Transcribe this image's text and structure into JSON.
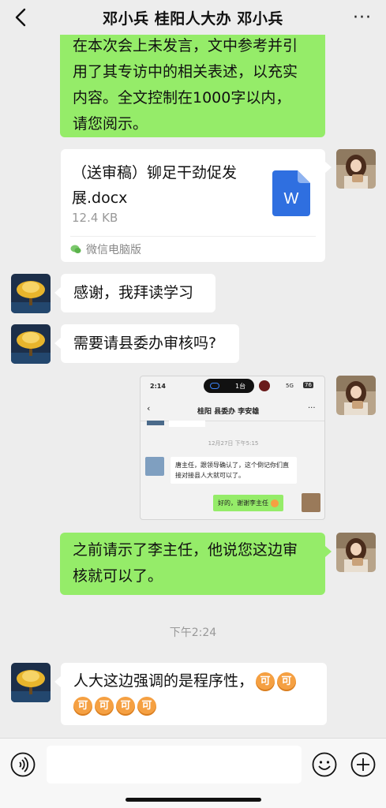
{
  "header": {
    "title": "邓小兵 桂阳人大办 邓小兵",
    "back_icon": "chevron-left-icon",
    "more_icon": "more-dots-icon",
    "more_label": "···"
  },
  "messages": [
    {
      "id": "m1",
      "side": "right",
      "lines": [
        "在本次会上未发言，文中参考并引",
        "用了其专访中的相关表述，以充实",
        "内容。全文控制在1000字以内，",
        "请您阅示。"
      ]
    },
    {
      "id": "m2",
      "side": "right",
      "type": "file",
      "file": {
        "name": "（送审稿）铆足干劲促发展.docx",
        "size": "12.4 KB",
        "source": "微信电脑版",
        "icon": "word-file-icon",
        "icon_letter": "W"
      }
    },
    {
      "id": "m3",
      "side": "left",
      "text": "感谢，我拜读学习"
    },
    {
      "id": "m4",
      "side": "left",
      "text": "需要请县委办审核吗?"
    },
    {
      "id": "m5",
      "side": "right",
      "type": "image",
      "screenshot": {
        "status_time": "2:14",
        "status_pill": "1台",
        "status_signal": "5G",
        "status_battery": "76",
        "title": "桂阳 县委办 李安雄",
        "timestamp": "12月27日 下午5:15",
        "left_msg": "唐主任，跟领导确认了，这个倒记你们直接对接县人大就可以了。",
        "right_msg": "好的，谢谢李主任"
      }
    },
    {
      "id": "m6",
      "side": "right",
      "lines": [
        "之前请示了李主任，他说您这边审",
        "核就可以了。"
      ]
    },
    {
      "id": "m7",
      "side": "left",
      "text": "人大这边强调的是程序性，",
      "emoji": [
        "可",
        "可",
        "可",
        "可",
        "可",
        "可"
      ]
    }
  ],
  "timestamp_divider": "下午2:24",
  "input_bar": {
    "voice_icon": "voice-icon",
    "emoji_icon": "emoji-icon",
    "plus_icon": "plus-icon",
    "placeholder": ""
  },
  "colors": {
    "my_bubble": "#95ec69",
    "their_bubble": "#ffffff",
    "background": "#ededed",
    "word_icon": "#2f6fe0"
  }
}
